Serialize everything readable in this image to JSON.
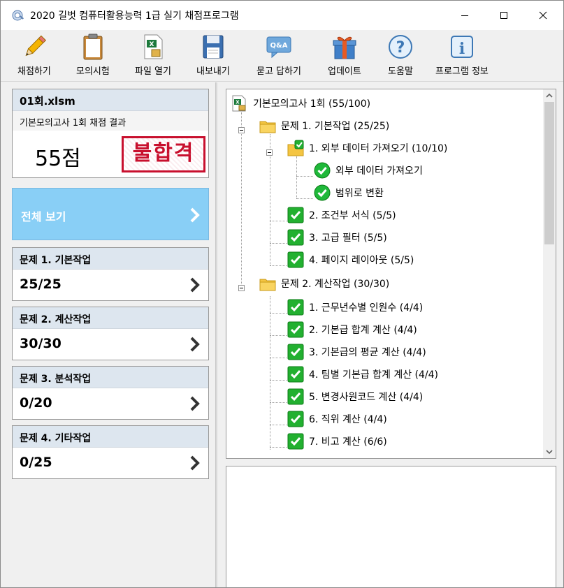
{
  "window": {
    "title": "2020 길벗 컴퓨터활용능력 1급 실기 채점프로그램"
  },
  "toolbar": [
    {
      "label": "채점하기",
      "icon": "pencil-icon"
    },
    {
      "label": "모의시험",
      "icon": "clipboard-icon"
    },
    {
      "label": "파일 열기",
      "icon": "excel-file-icon"
    },
    {
      "label": "내보내기",
      "icon": "floppy-disk-icon"
    },
    {
      "label": "묻고 답하기",
      "icon": "qa-speech-bubble-icon"
    },
    {
      "label": "업데이트",
      "icon": "gift-box-icon"
    },
    {
      "label": "도움말",
      "icon": "question-mark-icon"
    },
    {
      "label": "프로그램 정보",
      "icon": "info-icon"
    }
  ],
  "result": {
    "file": "01회.xlsm",
    "subtitle": "기본모의고사 1회 채점 결과",
    "score": "55점",
    "verdict": "불합격"
  },
  "view_all": {
    "label": "전체 보기"
  },
  "problems": [
    {
      "title": "문제 1. 기본작업",
      "score": "25/25"
    },
    {
      "title": "문제 2. 계산작업",
      "score": "30/30"
    },
    {
      "title": "문제 3. 분석작업",
      "score": "0/20"
    },
    {
      "title": "문제 4. 기타작업",
      "score": "0/25"
    }
  ],
  "tree": {
    "root": "기본모의고사 1회 (55/100)",
    "nodes": [
      "문제 1. 기본작업 (25/25)",
      "1. 외부 데이터 가져오기 (10/10)",
      "외부 데이터 가져오기",
      "범위로 변환",
      "2. 조건부 서식 (5/5)",
      "3. 고급 필터 (5/5)",
      "4. 페이지 레이아웃 (5/5)",
      "문제 2. 계산작업 (30/30)",
      "1. 근무년수별 인원수 (4/4)",
      "2. 기본급 합계 계산 (4/4)",
      "3. 기본급의 평균 계산 (4/4)",
      "4. 팀별 기본급 합계 계산 (4/4)",
      "5. 변경사원코드 계산 (4/4)",
      "6. 직위 계산 (4/4)",
      "7. 비고 계산 (6/6)"
    ]
  },
  "colors": {
    "accent": "#89cff6",
    "fail": "#c8102e",
    "header_bg": "#dde6ef"
  }
}
